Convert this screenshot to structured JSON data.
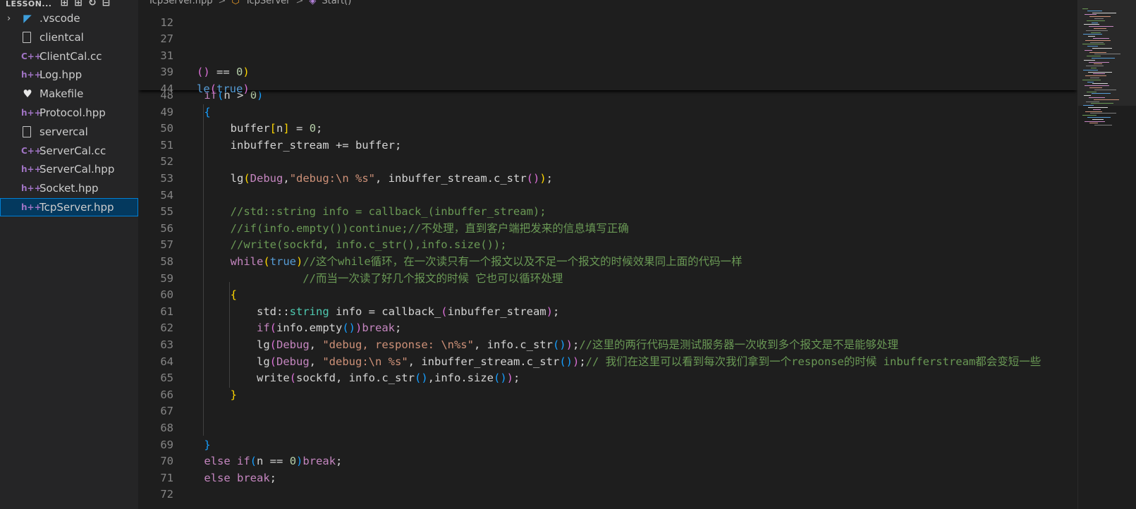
{
  "explorer": {
    "title": "LESSON...",
    "actions": [
      "new-file-icon",
      "new-folder-icon",
      "refresh-icon",
      "collapse-icon"
    ],
    "items": [
      {
        "label": ".vscode",
        "icon": "vscode-folder-icon",
        "chevron": "›"
      },
      {
        "label": "clientcal",
        "icon": "file-icon"
      },
      {
        "label": "ClientCal.cc",
        "icon": "cpp-file-icon",
        "glyph": "C++"
      },
      {
        "label": "Log.hpp",
        "icon": "hpp-file-icon",
        "glyph": "h++"
      },
      {
        "label": "Makefile",
        "icon": "makefile-icon",
        "glyph": "♥"
      },
      {
        "label": "Protocol.hpp",
        "icon": "hpp-file-icon",
        "glyph": "h++"
      },
      {
        "label": "servercal",
        "icon": "file-icon"
      },
      {
        "label": "ServerCal.cc",
        "icon": "cpp-file-icon",
        "glyph": "C++"
      },
      {
        "label": "ServerCal.hpp",
        "icon": "hpp-file-icon",
        "glyph": "h++"
      },
      {
        "label": "Socket.hpp",
        "icon": "hpp-file-icon",
        "glyph": "h++"
      },
      {
        "label": "TcpServer.hpp",
        "icon": "hpp-file-icon",
        "glyph": "h++",
        "selected": true
      }
    ]
  },
  "breadcrumb": {
    "file": "TcpServer.hpp",
    "class": "TcpServer",
    "method": "Start()",
    "separator": ">"
  },
  "sticky_scroll": [
    {
      "ln": "12",
      "tokens": []
    },
    {
      "ln": "27",
      "tokens": []
    },
    {
      "ln": "31",
      "tokens": []
    },
    {
      "ln": "39",
      "tokens": [
        [
          "b2",
          "()"
        ],
        [
          "var",
          " == "
        ],
        [
          "num",
          "0"
        ],
        [
          "b1",
          ")"
        ]
      ]
    },
    {
      "ln": "44",
      "tokens": [
        [
          "kw",
          "le"
        ],
        [
          "b2",
          "("
        ],
        [
          "kw",
          "true"
        ],
        [
          "b2",
          ")"
        ]
      ]
    }
  ],
  "code_lines": [
    {
      "ln": "48",
      "tokens": [
        [
          "var",
          " "
        ],
        [
          "ctl",
          "if"
        ],
        [
          "b3",
          "("
        ],
        [
          "var",
          "n > "
        ],
        [
          "num",
          "0"
        ],
        [
          "b3",
          ")"
        ]
      ]
    },
    {
      "ln": "49",
      "tokens": [
        [
          "var",
          " "
        ],
        [
          "b3",
          "{"
        ]
      ]
    },
    {
      "ln": "50",
      "tokens": [
        [
          "var",
          "     buffer"
        ],
        [
          "b1",
          "["
        ],
        [
          "var",
          "n"
        ],
        [
          "b1",
          "]"
        ],
        [
          "var",
          " = "
        ],
        [
          "num",
          "0"
        ],
        [
          "var",
          ";"
        ]
      ]
    },
    {
      "ln": "51",
      "tokens": [
        [
          "var",
          "     inbuffer_stream += buffer;"
        ]
      ]
    },
    {
      "ln": "52",
      "tokens": []
    },
    {
      "ln": "53",
      "tokens": [
        [
          "var",
          "     lg"
        ],
        [
          "b1",
          "("
        ],
        [
          "ctl",
          "Debug"
        ],
        [
          "var",
          ","
        ],
        [
          "str",
          "\"debug:\\n %s\""
        ],
        [
          "var",
          ", inbuffer_stream.c_str"
        ],
        [
          "b2",
          "()"
        ],
        [
          "b1",
          ")"
        ],
        [
          "var",
          ";"
        ]
      ]
    },
    {
      "ln": "54",
      "tokens": []
    },
    {
      "ln": "55",
      "tokens": [
        [
          "com",
          "     //std::string info = callback_(inbuffer_stream);"
        ]
      ]
    },
    {
      "ln": "56",
      "tokens": [
        [
          "com",
          "     //if(info.empty())continue;//不处理，直到客户端把发来的信息填写正确"
        ]
      ]
    },
    {
      "ln": "57",
      "tokens": [
        [
          "com",
          "     //write(sockfd, info.c_str(),info.size());"
        ]
      ]
    },
    {
      "ln": "58",
      "tokens": [
        [
          "var",
          "     "
        ],
        [
          "ctl",
          "while"
        ],
        [
          "b1",
          "("
        ],
        [
          "kw",
          "true"
        ],
        [
          "b1",
          ")"
        ],
        [
          "com",
          "//这个while循环，在一次读只有一个报文以及不足一个报文的时候效果同上面的代码一样"
        ]
      ]
    },
    {
      "ln": "59",
      "tokens": [
        [
          "com",
          "                //而当一次读了好几个报文的时候 它也可以循环处理"
        ]
      ]
    },
    {
      "ln": "60",
      "tokens": [
        [
          "var",
          "     "
        ],
        [
          "b1",
          "{"
        ]
      ]
    },
    {
      "ln": "61",
      "tokens": [
        [
          "var",
          "         std::"
        ],
        [
          "ty",
          "string"
        ],
        [
          "var",
          " info = callback_"
        ],
        [
          "b2",
          "("
        ],
        [
          "var",
          "inbuffer_stream"
        ],
        [
          "b2",
          ")"
        ],
        [
          "var",
          ";"
        ]
      ]
    },
    {
      "ln": "62",
      "tokens": [
        [
          "var",
          "         "
        ],
        [
          "ctl",
          "if"
        ],
        [
          "b2",
          "("
        ],
        [
          "var",
          "info.empty"
        ],
        [
          "b3",
          "()"
        ],
        [
          "b2",
          ")"
        ],
        [
          "ctl",
          "break"
        ],
        [
          "var",
          ";"
        ]
      ]
    },
    {
      "ln": "63",
      "tokens": [
        [
          "var",
          "         lg"
        ],
        [
          "b2",
          "("
        ],
        [
          "ctl",
          "Debug"
        ],
        [
          "var",
          ", "
        ],
        [
          "str",
          "\"debug, response: \\n%s\""
        ],
        [
          "var",
          ", info.c_str"
        ],
        [
          "b3",
          "()"
        ],
        [
          "b2",
          ")"
        ],
        [
          "var",
          ";"
        ],
        [
          "com",
          "//这里的两行代码是测试服务器一次收到多个报文是不是能够处理"
        ]
      ]
    },
    {
      "ln": "64",
      "tokens": [
        [
          "var",
          "         lg"
        ],
        [
          "b2",
          "("
        ],
        [
          "ctl",
          "Debug"
        ],
        [
          "var",
          ", "
        ],
        [
          "str",
          "\"debug:\\n %s\""
        ],
        [
          "var",
          ", inbuffer_stream.c_str"
        ],
        [
          "b3",
          "()"
        ],
        [
          "b2",
          ")"
        ],
        [
          "var",
          ";"
        ],
        [
          "com",
          "// 我们在这里可以看到每次我们拿到一个response的时候 inbufferstream都会变短一些"
        ]
      ]
    },
    {
      "ln": "65",
      "tokens": [
        [
          "var",
          "         write"
        ],
        [
          "b2",
          "("
        ],
        [
          "var",
          "sockfd, info.c_str"
        ],
        [
          "b3",
          "()"
        ],
        [
          "var",
          ",info.size"
        ],
        [
          "b3",
          "()"
        ],
        [
          "b2",
          ")"
        ],
        [
          "var",
          ";"
        ]
      ]
    },
    {
      "ln": "66",
      "tokens": [
        [
          "var",
          "     "
        ],
        [
          "b1",
          "}"
        ]
      ]
    },
    {
      "ln": "67",
      "tokens": []
    },
    {
      "ln": "68",
      "tokens": []
    },
    {
      "ln": "69",
      "tokens": [
        [
          "var",
          " "
        ],
        [
          "b3",
          "}"
        ]
      ]
    },
    {
      "ln": "70",
      "tokens": [
        [
          "var",
          " "
        ],
        [
          "ctl",
          "else if"
        ],
        [
          "b3",
          "("
        ],
        [
          "var",
          "n == "
        ],
        [
          "num",
          "0"
        ],
        [
          "b3",
          ")"
        ],
        [
          "ctl",
          "break"
        ],
        [
          "var",
          ";"
        ]
      ]
    },
    {
      "ln": "71",
      "tokens": [
        [
          "var",
          " "
        ],
        [
          "ctl",
          "else break"
        ],
        [
          "var",
          ";"
        ]
      ]
    },
    {
      "ln": "72",
      "tokens": []
    }
  ],
  "colors": {
    "keyword": "#569cd6",
    "control": "#c586c0",
    "string": "#ce9178",
    "number": "#b5cea8",
    "comment": "#6a9955",
    "bracket_gold": "#ffd700",
    "bracket_pink": "#da70d6",
    "bracket_blue": "#179fff",
    "selection": "#04395e"
  }
}
